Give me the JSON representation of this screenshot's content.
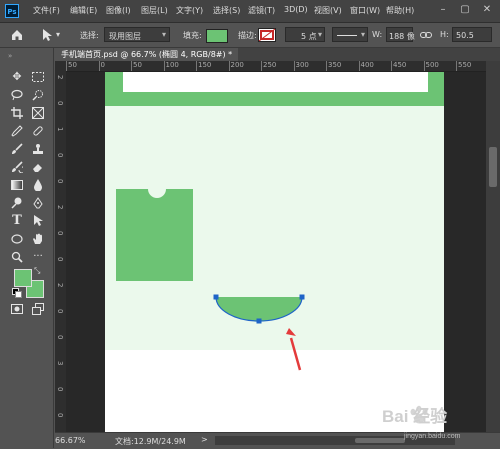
{
  "app": {
    "logo": "Ps"
  },
  "menu": [
    "文件(F)",
    "编辑(E)",
    "图像(I)",
    "图层(L)",
    "文字(Y)",
    "选择(S)",
    "滤镜(T)",
    "3D(D)",
    "视图(V)",
    "窗口(W)",
    "帮助(H)"
  ],
  "options": {
    "select_label": "选择:",
    "select_value": "现用图层",
    "fill_label": "填充:",
    "fill_color": "#6cc374",
    "stroke_label": "描边:",
    "stroke_size": "5 点",
    "w_label": "W:",
    "w_value": "188 像",
    "h_label": "H:",
    "h_value": "50.5"
  },
  "tab": {
    "title": "手机端首页.psd @ 66.7% (椭圆 4, RGB/8#) *",
    "close": "×"
  },
  "ruler_top_ticks": [
    "50",
    "0",
    "50",
    "100",
    "150",
    "200",
    "250",
    "300",
    "350",
    "400",
    "450",
    "500",
    "550"
  ],
  "ruler_left_ticks": [
    "2",
    "0",
    "1",
    "0",
    "0",
    "2",
    "0",
    "0",
    "2",
    "0",
    "0",
    "3",
    "0",
    "0"
  ],
  "status": {
    "zoom": "66.67%",
    "doc_info": "文档:12.9M/24.9M",
    "nav_arrow": ">"
  },
  "colors": {
    "foreground": "#6cc374",
    "background": "#6cc374",
    "shape_green": "#6cc374",
    "light_green": "#ebf9ec",
    "path_blue": "#1e64c8",
    "arrow_red": "#e33b3b"
  },
  "icons": [
    "move-icon",
    "marquee-icon",
    "lasso-icon",
    "quick-select-icon",
    "crop-icon",
    "frame-icon",
    "eyedropper-icon",
    "spot-heal-icon",
    "brush-icon",
    "stamp-icon",
    "history-brush-icon",
    "eraser-icon",
    "gradient-icon",
    "blur-icon",
    "dodge-icon",
    "pen-icon",
    "type-icon",
    "path-select-icon",
    "ellipse-icon",
    "hand-icon",
    "zoom-icon",
    "more-icon"
  ],
  "watermark": {
    "text": "Bai 经验",
    "sub": "jingyan.baidu.com"
  }
}
